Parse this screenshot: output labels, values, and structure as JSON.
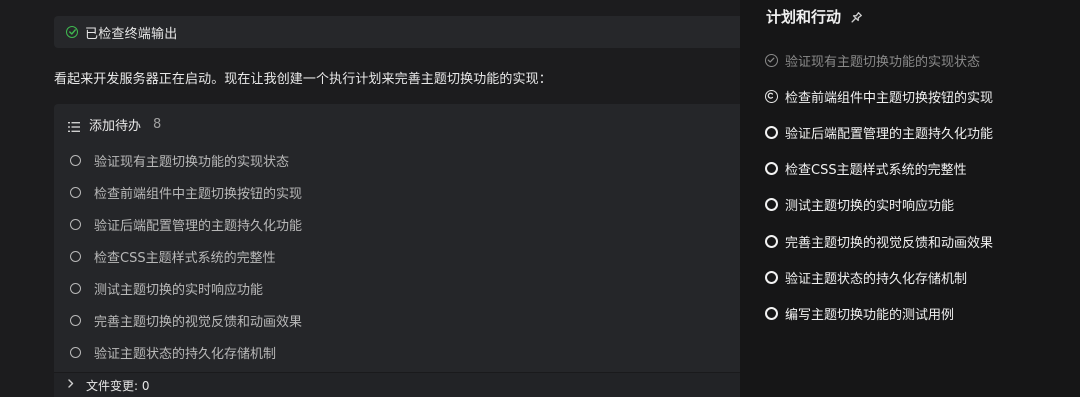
{
  "terminal_check": {
    "label": "已检查终端输出"
  },
  "message": {
    "text": "看起来开发服务器正在启动。现在让我创建一个执行计划来完善主题切换功能的实现："
  },
  "todo_card": {
    "title": "添加待办",
    "count": "8",
    "items": [
      {
        "label": "验证现有主题切换功能的实现状态"
      },
      {
        "label": "检查前端组件中主题切换按钮的实现"
      },
      {
        "label": "验证后端配置管理的主题持久化功能"
      },
      {
        "label": "检查CSS主题样式系统的完整性"
      },
      {
        "label": "测试主题切换的实时响应功能"
      },
      {
        "label": "完善主题切换的视觉反馈和动画效果"
      },
      {
        "label": "验证主题状态的持久化存储机制"
      }
    ]
  },
  "file_changes": {
    "label": "文件变更: 0"
  },
  "plan_panel": {
    "title": "计划和行动",
    "items": [
      {
        "label": "验证现有主题切换功能的实现状态",
        "status": "done"
      },
      {
        "label": "检查前端组件中主题切换按钮的实现",
        "status": "in-progress"
      },
      {
        "label": "验证后端配置管理的主题持久化功能",
        "status": "pending"
      },
      {
        "label": "检查CSS主题样式系统的完整性",
        "status": "pending"
      },
      {
        "label": "测试主题切换的实时响应功能",
        "status": "pending"
      },
      {
        "label": "完善主题切换的视觉反馈和动画效果",
        "status": "pending"
      },
      {
        "label": "验证主题状态的持久化存储机制",
        "status": "pending"
      },
      {
        "label": "编写主题切换功能的测试用例",
        "status": "pending"
      }
    ]
  },
  "colors": {
    "success": "#3fb950",
    "panel_bg": "#161617",
    "card_bg": "#252629"
  },
  "icons": {
    "terminal_check": "check-circle-icon",
    "todo_header": "list-icon",
    "plan_pin": "pin-icon",
    "file_changes": "chevron-right-icon"
  }
}
